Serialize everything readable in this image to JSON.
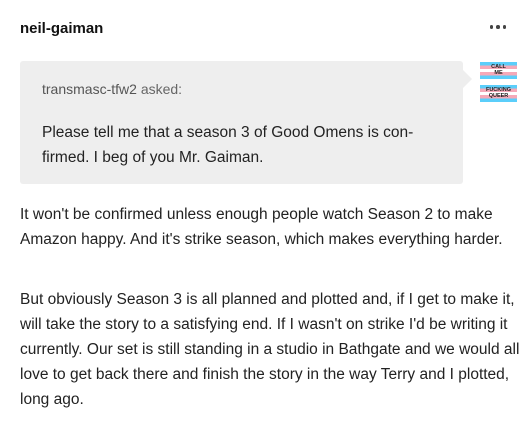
{
  "post": {
    "author": "neil-gaiman",
    "ask": {
      "asker": "transmasc-tfw2",
      "asked_label": "asked:",
      "question": "Please tell me that a season 3 of Good Omens is con-firmed. I beg of you Mr. Gaiman."
    },
    "avatar": {
      "line1": "CALL",
      "line2": "ME",
      "line3": "FUCKING",
      "line4": "QUEER",
      "colors": [
        "#5bcefa",
        "#f5a9b8",
        "#ffffff"
      ]
    },
    "answer": [
      "It won't be confirmed unless enough people watch Season 2 to make Amazon happy. And it's strike season, which makes everything harder.",
      "But obviously Season 3 is all planned and plotted and, if I get to make it, will take the story to a satisfying end. If I wasn't on strike I'd be writing it currently. Our set is still standing in a studio in Bathgate and we would all love to get back there and finish the story in the way Terry and I plotted, long ago."
    ]
  }
}
